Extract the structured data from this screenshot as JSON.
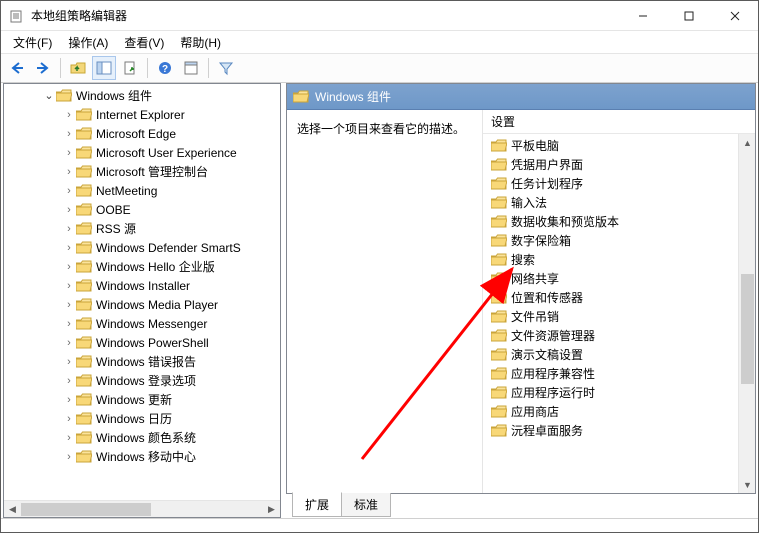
{
  "window": {
    "title": "本地组策略编辑器"
  },
  "menu": {
    "file": "文件(F)",
    "action": "操作(A)",
    "view": "查看(V)",
    "help": "帮助(H)"
  },
  "tree": {
    "root": "Windows 组件",
    "items": [
      "Internet Explorer",
      "Microsoft Edge",
      "Microsoft User Experience",
      "Microsoft 管理控制台",
      "NetMeeting",
      "OOBE",
      "RSS 源",
      "Windows Defender SmartS",
      "Windows Hello 企业版",
      "Windows Installer",
      "Windows Media Player",
      "Windows Messenger",
      "Windows PowerShell",
      "Windows 错误报告",
      "Windows 登录选项",
      "Windows 更新",
      "Windows 日历",
      "Windows 颜色系统",
      "Windows 移动中心"
    ]
  },
  "right": {
    "header": "Windows 组件",
    "desc": "选择一个项目来查看它的描述。",
    "col_header": "设置",
    "items": [
      "平板电脑",
      "凭据用户界面",
      "任务计划程序",
      "输入法",
      "数据收集和预览版本",
      "数字保险箱",
      "搜索",
      "网络共享",
      "位置和传感器",
      "文件吊销",
      "文件资源管理器",
      "演示文稿设置",
      "应用程序兼容性",
      "应用程序运行时",
      "应用商店",
      "沅程卓面服务"
    ]
  },
  "tabs": {
    "extended": "扩展",
    "standard": "标准"
  }
}
